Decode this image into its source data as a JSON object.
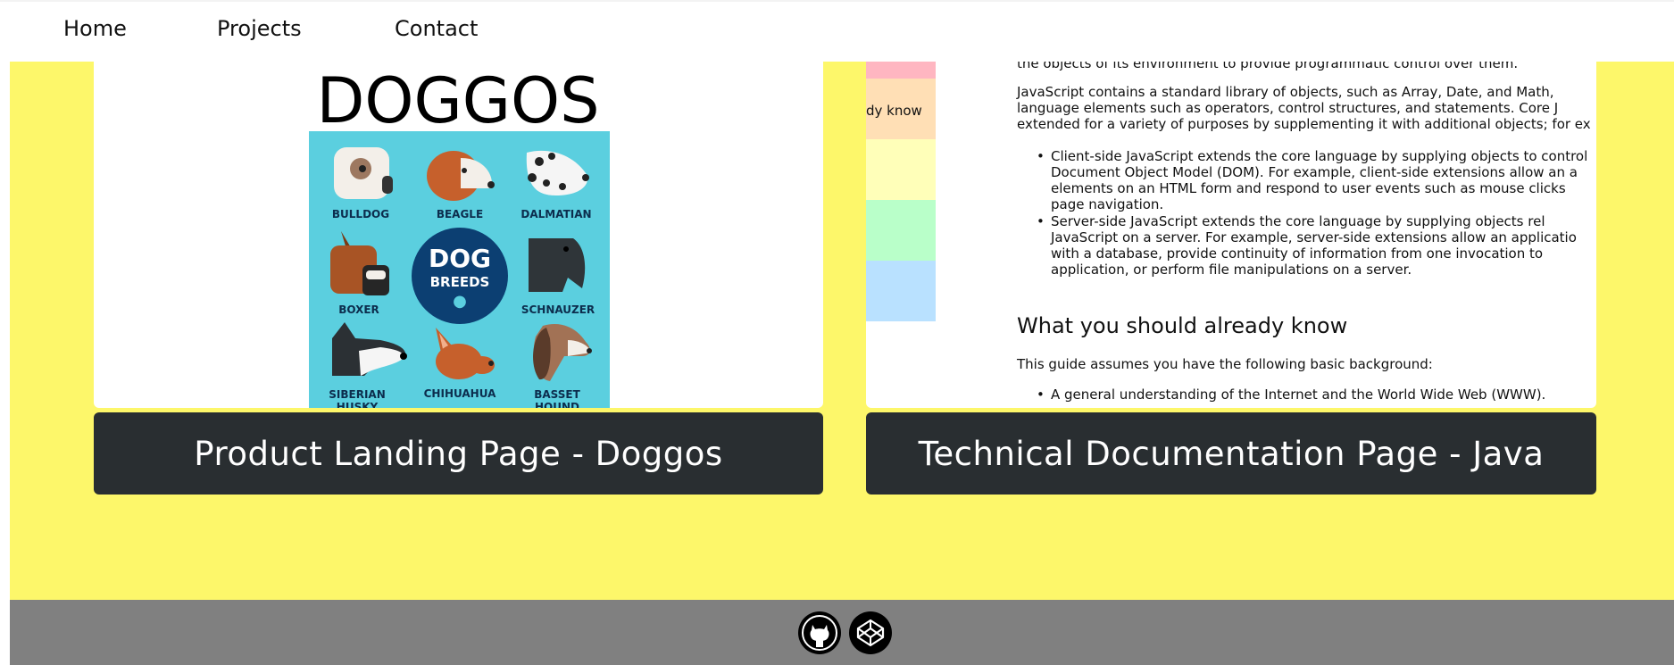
{
  "nav": {
    "home": "Home",
    "projects": "Projects",
    "contact": "Contact"
  },
  "projects": [
    {
      "button_label": "Product Landing Page - Doggos",
      "thumbnail": {
        "title": "DOGGOS",
        "badge_line1": "DOG",
        "badge_line2": "BREEDS",
        "breeds": [
          "BULLDOG",
          "BEAGLE",
          "DALMATIAN",
          "BOXER",
          "SCHNAUZER",
          "SIBERIAN HUSKY",
          "CHIHUAHUA",
          "BASSET HOUND"
        ]
      }
    },
    {
      "button_label": "Technical Documentation Page - Java",
      "thumbnail": {
        "sidebar_fragment": "dy know",
        "line_top": "the objects of its environment to provide programmatic control over them.",
        "para2_l1": "JavaScript contains a standard library of objects, such as Array, Date, and Math,",
        "para2_l2": "language elements such as operators, control structures, and statements. Core J",
        "para2_l3": "extended for a variety of purposes by supplementing it with additional objects; for ex",
        "b1_l1": "Client-side JavaScript extends the core language by supplying objects to control",
        "b1_l2": "Document Object Model (DOM). For example, client-side extensions allow an a",
        "b1_l3": "elements on an HTML form and respond to user events such as mouse clicks",
        "b1_l4": "page navigation.",
        "b2_l1": "Server-side JavaScript extends the core language by supplying objects rel",
        "b2_l2": "JavaScript on a server. For example, server-side extensions allow an applicatio",
        "b2_l3": "with a database, provide continuity of information from one invocation to",
        "b2_l4": "application, or perform file manipulations on a server.",
        "heading": "What you should already know",
        "intro": "This guide assumes you have the following basic background:",
        "b3_l1": "A general understanding of the Internet and the World Wide Web (WWW)."
      }
    }
  ],
  "footer": {
    "icons": [
      "github-icon",
      "codepen-icon"
    ]
  },
  "colors": {
    "page_bg": "#fdf76a",
    "button_bg": "#292e31",
    "footer_bg": "#808080",
    "swatches": [
      "#ffb6c1",
      "#ffdfb5",
      "#ffffb9",
      "#b9ffc9",
      "#b9e1ff"
    ]
  }
}
